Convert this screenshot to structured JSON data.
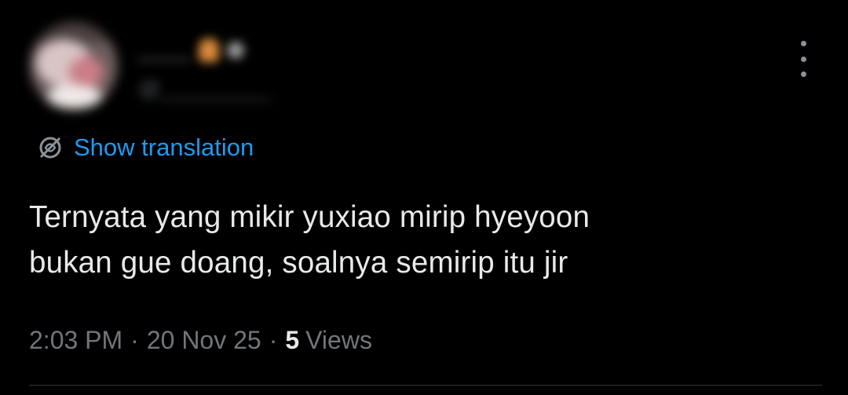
{
  "author": {
    "display_name": "____",
    "handle": "@_________"
  },
  "translate": {
    "label": "Show translation"
  },
  "tweet": {
    "line1": "Ternyata yang mikir yuxiao mirip hyeyoon",
    "line2": "bukan gue doang, soalnya semirip itu jir"
  },
  "meta": {
    "time": "2:03 PM",
    "separator": "·",
    "date": "20 Nov 25",
    "views_count": "5",
    "views_label": "Views"
  },
  "colors": {
    "background": "#000000",
    "text": "#e7e9ea",
    "muted": "#71767b",
    "link": "#1d9bf0"
  },
  "icons": {
    "translate": "globe-icon",
    "more": "more-horizontal-icon"
  }
}
